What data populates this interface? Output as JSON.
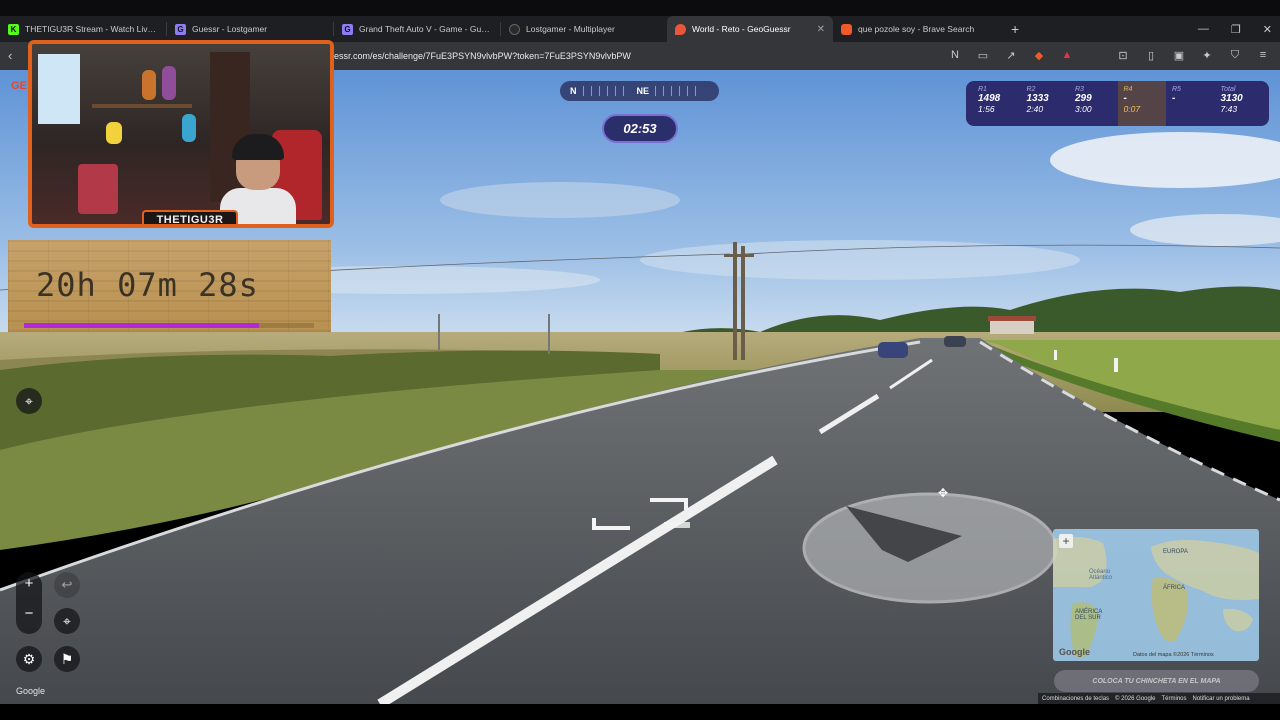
{
  "browser": {
    "tabs": [
      {
        "title": "THETIGU3R Stream - Watch Live on K",
        "favicon_color": "#53fc18",
        "favicon_glyph": "K",
        "active": false
      },
      {
        "title": "Guessr - Lostgamer",
        "favicon_color": "#8f7cf2",
        "favicon_glyph": "G",
        "active": false
      },
      {
        "title": "Grand Theft Auto V - Game - Guessr",
        "favicon_color": "#8f7cf2",
        "favicon_glyph": "G",
        "active": false
      },
      {
        "title": "Lostgamer - Multiplayer",
        "favicon_color": "#2b2b2b",
        "favicon_glyph": "",
        "active": false
      },
      {
        "title": "World - Reto - GeoGuessr",
        "favicon_color": "#e8563c",
        "favicon_glyph": "",
        "active": true
      },
      {
        "title": "que pozole soy - Brave Search",
        "favicon_color": "#f05a28",
        "favicon_glyph": "",
        "active": false
      }
    ],
    "new_tab_icon": "plus-icon",
    "url": "essr.com/es/challenge/7FuE3PSYN9vlvbPW?token=7FuE3PSYN9vlvbPW"
  },
  "hud": {
    "compass": {
      "left_label": "N",
      "center_label": "NE"
    },
    "timer": "02:53",
    "rounds": [
      {
        "label": "R1",
        "points": "1498",
        "time": "1:56",
        "active": false
      },
      {
        "label": "R2",
        "points": "1333",
        "time": "2:40",
        "active": false
      },
      {
        "label": "R3",
        "points": "299",
        "time": "3:00",
        "active": false
      },
      {
        "label": "R4",
        "points": "-",
        "time": "0:07",
        "active": true
      },
      {
        "label": "R5",
        "points": "-",
        "time": "",
        "active": false
      },
      {
        "label": "Total",
        "points": "3130",
        "time": "7:43",
        "active": false
      }
    ]
  },
  "overlay": {
    "streamer_name": "THETIGU3R",
    "countdown": "20h 07m 28s",
    "countdown_progress": 0.81,
    "logo_fragment": "GE"
  },
  "controls": {
    "zoom_in": "+",
    "zoom_out": "−"
  },
  "map": {
    "labels": {
      "europe": "EUROPA",
      "africa": "ÁFRICA",
      "south_america": "AMÉRICA DEL SUR",
      "north_atlantic": "Océano Atlántico"
    },
    "google": "Google",
    "attribution": "Datos del mapa ©2026   Términos",
    "guess_button": "COLOCA TU CHINCHETA EN EL MAPA"
  },
  "footer": {
    "items": [
      "Combinaciones de teclas",
      "© 2026 Google",
      "Términos",
      "Notificar un problema"
    ]
  },
  "google_watermark": "Google",
  "colors": {
    "accent": "#7b6fd6",
    "scoreboard": "#26226a",
    "active_round": "#e3b44f",
    "progress": "#b12ad6"
  }
}
